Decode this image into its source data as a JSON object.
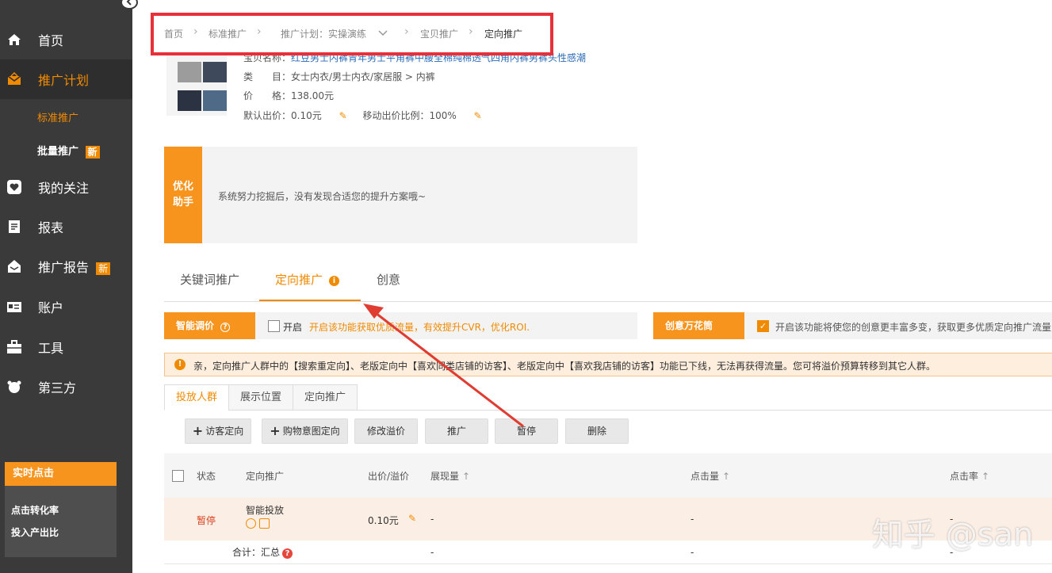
{
  "sidebar": {
    "items": [
      {
        "label": "首页",
        "icon": "home-icon"
      },
      {
        "label": "推广计划",
        "icon": "campaign-icon"
      },
      {
        "label": "我的关注",
        "icon": "heart-icon"
      },
      {
        "label": "报表",
        "icon": "report-icon"
      },
      {
        "label": "推广报告",
        "icon": "report-house-icon",
        "badge": "新"
      },
      {
        "label": "账户",
        "icon": "account-card-icon"
      },
      {
        "label": "工具",
        "icon": "toolbox-icon"
      },
      {
        "label": "第三方",
        "icon": "thirdparty-icon"
      }
    ],
    "subitems": [
      {
        "label": "标准推广"
      },
      {
        "label": "批量推广",
        "badge": "新"
      }
    ],
    "realtime": {
      "title": "实时点击",
      "lines": [
        "点击转化率",
        "投入产出比"
      ]
    }
  },
  "breadcrumb": {
    "home": "首页",
    "standard": "标准推广",
    "plan": "推广计划：实操演练",
    "item": "宝贝推广",
    "current": "定向推广"
  },
  "product": {
    "name_label": "宝贝名称：",
    "name_value": "红豆男士内裤青年男士平角裤中腰全棉纯棉透气四角内裤男裤头性感潮",
    "category_label": "类　　目：",
    "category_value": "女士内衣/男士内衣/家居服 > 内裤",
    "price_label": "价　　格：",
    "price_value": "138.00元",
    "bid_label": "默认出价：",
    "bid_value": "0.10元",
    "mobile_ratio_label": "移动出价比例：",
    "mobile_ratio_value": "100%"
  },
  "optimizer": {
    "tag": "优化助手",
    "text": "系统努力挖掘后，没有发现合适您的提升方案哦~"
  },
  "main_tabs": [
    "关键词推广",
    "定向推广",
    "创意"
  ],
  "smart_bid": {
    "tag": "智能调价",
    "checkbox_label": "开启",
    "desc": "开启该功能获取优质流量，有效提升CVR，优化ROI."
  },
  "creative": {
    "tag": "创意万花筒",
    "desc": "开启该功能将使您的创意更丰富多变，获取更多优质定向推广流量"
  },
  "notice": {
    "text": "亲，定向推广人群中的【搜索重定向】、老版定向中【喜欢同类店铺的访客】、老版定向中【喜欢我店铺的访客】功能已下线，无法再获得流量。您可将溢价预算转移到其它人群。"
  },
  "sub_tabs": [
    "投放人群",
    "展示位置",
    "定向推广"
  ],
  "actions": [
    "访客定向",
    "购物意图定向",
    "修改溢价",
    "推广",
    "暂停",
    "删除"
  ],
  "table": {
    "headers": {
      "status": "状态",
      "target": "定向推广",
      "bid": "出价/溢价",
      "impressions": "展现量",
      "clicks": "点击量",
      "ctr": "点击率"
    },
    "row": {
      "status": "暂停",
      "target": "智能投放",
      "bid": "0.10元",
      "impressions": "-",
      "clicks": "-",
      "ctr": "-"
    },
    "total": {
      "label": "合计：汇总",
      "impressions": "-",
      "clicks": "-",
      "ctr": "-"
    }
  },
  "watermark": "知乎 @san",
  "colors": {
    "accent": "#f08a00",
    "sidebar_bg": "#3a3a3a",
    "highlight_box": "#e8303a"
  }
}
